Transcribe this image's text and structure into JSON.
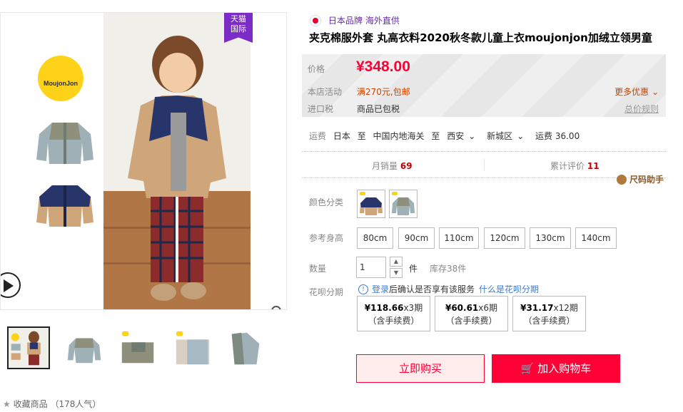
{
  "gallery": {
    "brand_logo_text": "MoujonJon",
    "badge_line1": "天猫",
    "badge_line2": "国际",
    "thumb_count": 5
  },
  "favorites": {
    "star": "★",
    "label": "收藏商品",
    "popularity": "（178人气）"
  },
  "product": {
    "origin_flag": "japan-flag-icon",
    "brand_tag": "日本品牌 海外直供",
    "title": "夹克棉服外套 丸高衣料2020秋冬款儿童上衣moujonjon加绒立领男童"
  },
  "price_box": {
    "price_label": "价格",
    "price": "¥348.00",
    "promo_label": "本店活动",
    "promo_value": "满270元,包邮",
    "more_promo": "更多优惠",
    "tax_label": "进口税",
    "tax_value": "商品已包税",
    "tax_rule": "总价规则"
  },
  "shipping": {
    "label": "运费",
    "from": "日本",
    "to_word": "至",
    "customs": "中国内地海关",
    "to_word2": "至",
    "city": "西安",
    "district": "新城区",
    "fee": "运费 36.00"
  },
  "stats": {
    "sales_label": "月销量",
    "sales_value": "69",
    "reviews_label": "累计评价",
    "reviews_value": "11"
  },
  "size_helper": "尺码助手",
  "options": {
    "color_label": "颜色分类",
    "height_label": "参考身高",
    "sizes": [
      "80cm",
      "90cm",
      "110cm",
      "120cm",
      "130cm",
      "140cm"
    ]
  },
  "quantity": {
    "label": "数量",
    "value": "1",
    "unit": "件",
    "stock": "库存38件"
  },
  "installments": {
    "label": "花呗分期",
    "info": "!",
    "login_link": "登录",
    "note": "后确认是否享有该服务",
    "what_link": "什么是花呗分期",
    "plans": [
      {
        "amount": "¥118.66",
        "period": "x3期",
        "fee": "（含手续费）"
      },
      {
        "amount": "¥60.61",
        "period": "x6期",
        "fee": "（含手续费）"
      },
      {
        "amount": "¥31.17",
        "period": "x12期",
        "fee": "（含手续费）"
      }
    ]
  },
  "actions": {
    "buy_now": "立即购买",
    "add_cart": "加入购物车"
  },
  "colors": {
    "accent": "#ff0036",
    "navy": "#27356a",
    "fleece": "#cfa679",
    "grey": "#8e9a8a"
  }
}
